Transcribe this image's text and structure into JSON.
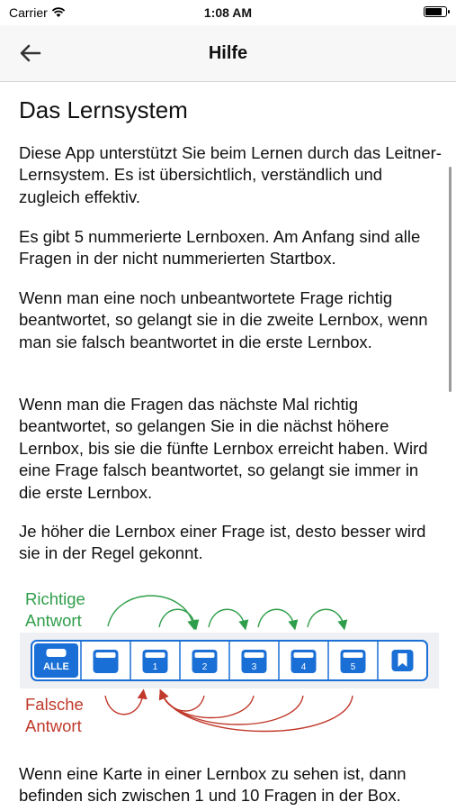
{
  "status_bar": {
    "carrier": "Carrier",
    "time": "1:08 AM"
  },
  "navbar": {
    "title": "Hilfe",
    "back_icon": "arrow-left-icon"
  },
  "content": {
    "heading": "Das Lernsystem",
    "paragraphs": [
      "Diese App unterstützt Sie beim Lernen durch das Leitner-Lernsystem. Es ist übersichtlich, verständlich und zugleich effektiv.",
      "Es gibt 5 nummerierte Lernboxen. Am Anfang sind alle Fragen in der nicht nummerierten Startbox.",
      "Wenn man eine noch unbeantwortete Frage richtig beantwortet, so gelangt sie in die zweite Lernbox, wenn man sie falsch beantwortet in die erste Lernbox.",
      "Wenn man die Fragen das nächste Mal richtig beantwortet, so gelangen Sie in die nächst höhere Lernbox, bis sie die fünfte Lernbox erreicht haben. Wird eine Frage falsch beantwortet, so gelangt sie immer in die erste Lernbox.",
      "Je höher die Lernbox einer Frage ist, desto besser wird sie in der Regel gekonnt.",
      "Wenn eine Karte in einer Lernbox zu sehen ist, dann befinden sich zwischen 1 und 10 Fragen in der Box."
    ],
    "diagram": {
      "correct_label_1": "Richtige",
      "correct_label_2": "Antwort",
      "wrong_label_1": "Falsche",
      "wrong_label_2": "Antwort",
      "boxes": [
        "ALLE",
        "",
        "1",
        "2",
        "3",
        "4",
        "5",
        ""
      ],
      "box_icons": [
        "all-boxes-icon",
        "start-box-icon",
        "box-1-icon",
        "box-2-icon",
        "box-3-icon",
        "box-4-icon",
        "box-5-icon",
        "learned-bookmark-icon"
      ],
      "colors": {
        "box": "#1a6fd6",
        "correct": "#2f9e4a",
        "wrong": "#c0392b",
        "strip": "#eef0f3"
      }
    }
  }
}
